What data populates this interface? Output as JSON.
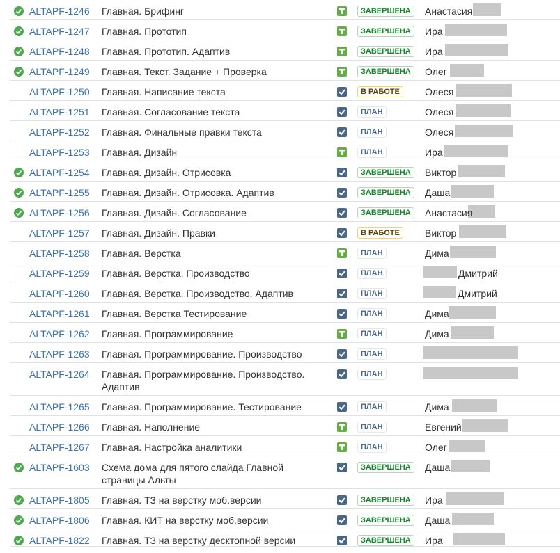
{
  "colors": {
    "link": "#3b73af",
    "status_done": "#14892c",
    "status_in_progress": "#594300",
    "status_plan": "#4a6785",
    "task_icon": "#67ab49",
    "subtask_icon": "#4a6785",
    "resolved_icon": "#4fa94f",
    "redaction": "#c8c8c8"
  },
  "issues": [
    {
      "resolved": true,
      "key": "ALTAPF-1246",
      "summary": "Главная. Брифинг",
      "type": "task-icon",
      "status": "ЗАВЕРШЕНА",
      "status_kind": "done",
      "assignee": "Анастасия"
    },
    {
      "resolved": true,
      "key": "ALTAPF-1247",
      "summary": "Главная. Прототип",
      "type": "task-icon",
      "status": "ЗАВЕРШЕНА",
      "status_kind": "done",
      "assignee": "Ира"
    },
    {
      "resolved": true,
      "key": "ALTAPF-1248",
      "summary": "Главная. Прототип. Адаптив",
      "type": "task-icon",
      "status": "ЗАВЕРШЕНА",
      "status_kind": "done",
      "assignee": "Ира"
    },
    {
      "resolved": true,
      "key": "ALTAPF-1249",
      "summary": "Главная. Текст. Задание + Проверка",
      "type": "task-icon",
      "status": "ЗАВЕРШЕНА",
      "status_kind": "done",
      "assignee": "Олег"
    },
    {
      "resolved": false,
      "key": "ALTAPF-1250",
      "summary": "Главная. Написание текста",
      "type": "subtask-icon",
      "status": "В РАБОТЕ",
      "status_kind": "progress",
      "assignee": "Олеся"
    },
    {
      "resolved": false,
      "key": "ALTAPF-1251",
      "summary": "Главная. Согласование текста",
      "type": "subtask-icon",
      "status": "ПЛАН",
      "status_kind": "plan",
      "assignee": "Олеся"
    },
    {
      "resolved": false,
      "key": "ALTAPF-1252",
      "summary": "Главная. Финальные правки текста",
      "type": "subtask-icon",
      "status": "ПЛАН",
      "status_kind": "plan",
      "assignee": "Олеся"
    },
    {
      "resolved": false,
      "key": "ALTAPF-1253",
      "summary": "Главная. Дизайн",
      "type": "task-icon",
      "status": "ПЛАН",
      "status_kind": "plan",
      "assignee": "Ира"
    },
    {
      "resolved": true,
      "key": "ALTAPF-1254",
      "summary": "Главная. Дизайн. Отрисовка",
      "type": "subtask-icon",
      "status": "ЗАВЕРШЕНА",
      "status_kind": "done",
      "assignee": "Виктор"
    },
    {
      "resolved": true,
      "key": "ALTAPF-1255",
      "summary": "Главная. Дизайн. Отрисовка. Адаптив",
      "type": "subtask-icon",
      "status": "ЗАВЕРШЕНА",
      "status_kind": "done",
      "assignee": "Даша"
    },
    {
      "resolved": true,
      "key": "ALTAPF-1256",
      "summary": "Главная. Дизайн. Согласование",
      "type": "subtask-icon",
      "status": "ЗАВЕРШЕНА",
      "status_kind": "done",
      "assignee": "Анастасия"
    },
    {
      "resolved": false,
      "key": "ALTAPF-1257",
      "summary": "Главная. Дизайн. Правки",
      "type": "subtask-icon",
      "status": "В РАБОТЕ",
      "status_kind": "progress",
      "assignee": "Виктор"
    },
    {
      "resolved": false,
      "key": "ALTAPF-1258",
      "summary": "Главная. Верстка",
      "type": "task-icon",
      "status": "ПЛАН",
      "status_kind": "plan",
      "assignee": "Дима"
    },
    {
      "resolved": false,
      "key": "ALTAPF-1259",
      "summary": "Главная. Верстка. Производство",
      "type": "subtask-icon",
      "status": "ПЛАН",
      "status_kind": "plan",
      "assignee": "Дмитрий"
    },
    {
      "resolved": false,
      "key": "ALTAPF-1260",
      "summary": "Главная. Верстка. Производство. Адаптив",
      "type": "subtask-icon",
      "status": "ПЛАН",
      "status_kind": "plan",
      "assignee": "Дмитрий"
    },
    {
      "resolved": false,
      "key": "ALTAPF-1261",
      "summary": "Главная. Верстка Тестирование",
      "type": "subtask-icon",
      "status": "ПЛАН",
      "status_kind": "plan",
      "assignee": "Дима"
    },
    {
      "resolved": false,
      "key": "ALTAPF-1262",
      "summary": "Главная. Программирование",
      "type": "task-icon",
      "status": "ПЛАН",
      "status_kind": "plan",
      "assignee": "Дима"
    },
    {
      "resolved": false,
      "key": "ALTAPF-1263",
      "summary": "Главная. Программирование. Производство",
      "type": "subtask-icon",
      "status": "ПЛАН",
      "status_kind": "plan",
      "assignee": ""
    },
    {
      "resolved": false,
      "key": "ALTAPF-1264",
      "summary": "Главная. Программирование. Производство. Адаптив",
      "type": "subtask-icon",
      "status": "ПЛАН",
      "status_kind": "plan",
      "assignee": ""
    },
    {
      "resolved": false,
      "key": "ALTAPF-1265",
      "summary": "Главная. Программирование. Тестирование",
      "type": "subtask-icon",
      "status": "ПЛАН",
      "status_kind": "plan",
      "assignee": "Дима"
    },
    {
      "resolved": false,
      "key": "ALTAPF-1266",
      "summary": "Главная. Наполнение",
      "type": "task-icon",
      "status": "ПЛАН",
      "status_kind": "plan",
      "assignee": "Евгений"
    },
    {
      "resolved": false,
      "key": "ALTAPF-1267",
      "summary": "Главная. Настройка аналитики",
      "type": "task-icon",
      "status": "ПЛАН",
      "status_kind": "plan",
      "assignee": "Олег"
    },
    {
      "resolved": true,
      "key": "ALTAPF-1603",
      "summary": "Схема дома для пятого слайда Главной страницы Альты",
      "type": "subtask-icon",
      "status": "ЗАВЕРШЕНА",
      "status_kind": "done",
      "assignee": "Даша"
    },
    {
      "resolved": true,
      "key": "ALTAPF-1805",
      "summary": "Главная. ТЗ на верстку моб.версии",
      "type": "subtask-icon",
      "status": "ЗАВЕРШЕНА",
      "status_kind": "done",
      "assignee": "Ира"
    },
    {
      "resolved": true,
      "key": "ALTAPF-1806",
      "summary": "Главная. КИТ на верстку моб.версии",
      "type": "subtask-icon",
      "status": "ЗАВЕРШЕНА",
      "status_kind": "done",
      "assignee": "Даша"
    },
    {
      "resolved": true,
      "key": "ALTAPF-1822",
      "summary": "Главная. ТЗ на верстку десктопной версии",
      "type": "subtask-icon",
      "status": "ЗАВЕРШЕНА",
      "status_kind": "done",
      "assignee": "Ира"
    }
  ]
}
